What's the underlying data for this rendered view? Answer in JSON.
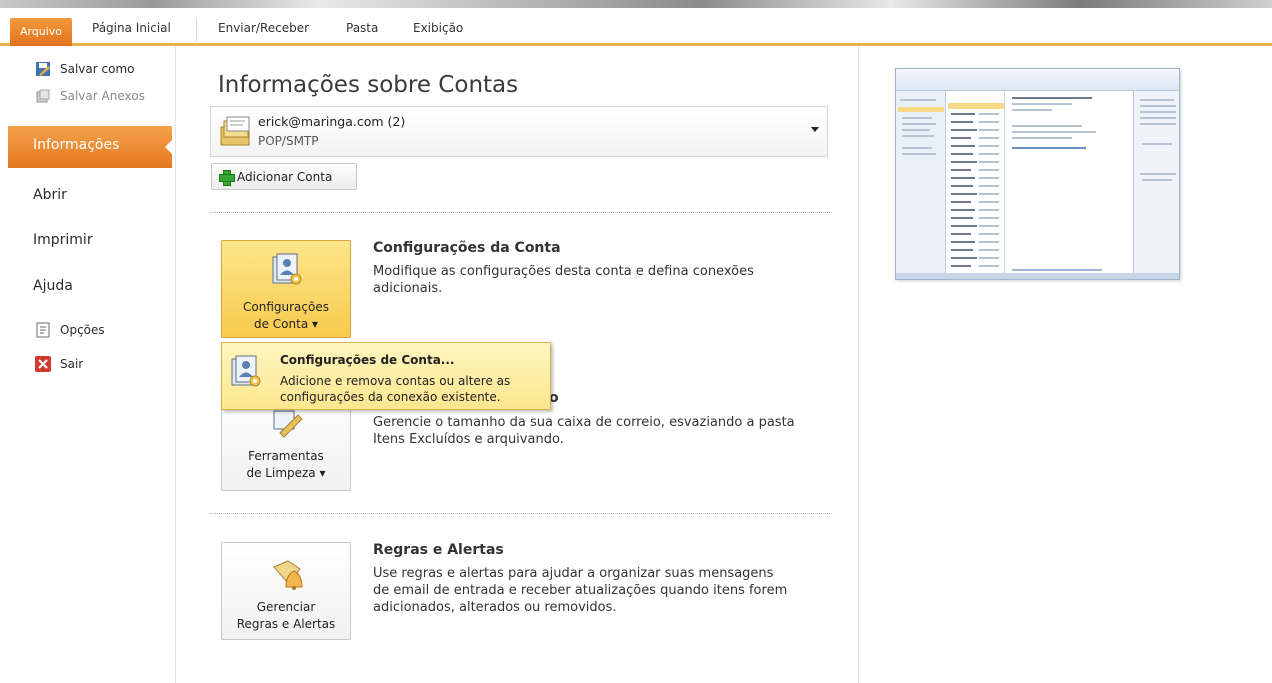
{
  "ribbon": {
    "file_tab": "Arquivo",
    "tabs": [
      "Página Inicial",
      "Enviar/Receber",
      "Pasta",
      "Exibição"
    ]
  },
  "nav": {
    "save_as": "Salvar como",
    "save_attachments": "Salvar Anexos",
    "info": "Informações",
    "open": "Abrir",
    "print": "Imprimir",
    "help": "Ajuda",
    "options": "Opções",
    "exit": "Sair"
  },
  "main": {
    "title": "Informações sobre Contas",
    "account": {
      "email": "erick@maringa.com (2)",
      "type": "POP/SMTP"
    },
    "add_account": "Adicionar Conta",
    "sections": [
      {
        "button_line1": "Configurações",
        "button_line2": "de Conta ▾",
        "title": "Configurações da Conta",
        "description": "Modifique as configurações desta conta e defina conexões adicionais."
      },
      {
        "button_line1": "Ferramentas",
        "button_line2": "de Limpeza ▾",
        "title": "o",
        "description": "Gerencie o tamanho da sua caixa de correio, esvaziando a pasta Itens Excluídos e arquivando."
      },
      {
        "button_line1": "Gerenciar",
        "button_line2": "Regras e Alertas",
        "title": "Regras e Alertas",
        "description": "Use regras e alertas para ajudar a organizar suas mensagens de email de entrada e receber atualizações quando itens forem adicionados, alterados ou removidos."
      }
    ],
    "dropdown": {
      "title": "Configurações de Conta...",
      "description": "Adicione e remova contas ou altere as configurações da conexão existente."
    }
  },
  "colors": {
    "file_tab": "#e2711e",
    "selected_nav": "#e4781f",
    "active_button": "#f7cb4d",
    "ribbon_underline": "#e8b24a"
  }
}
